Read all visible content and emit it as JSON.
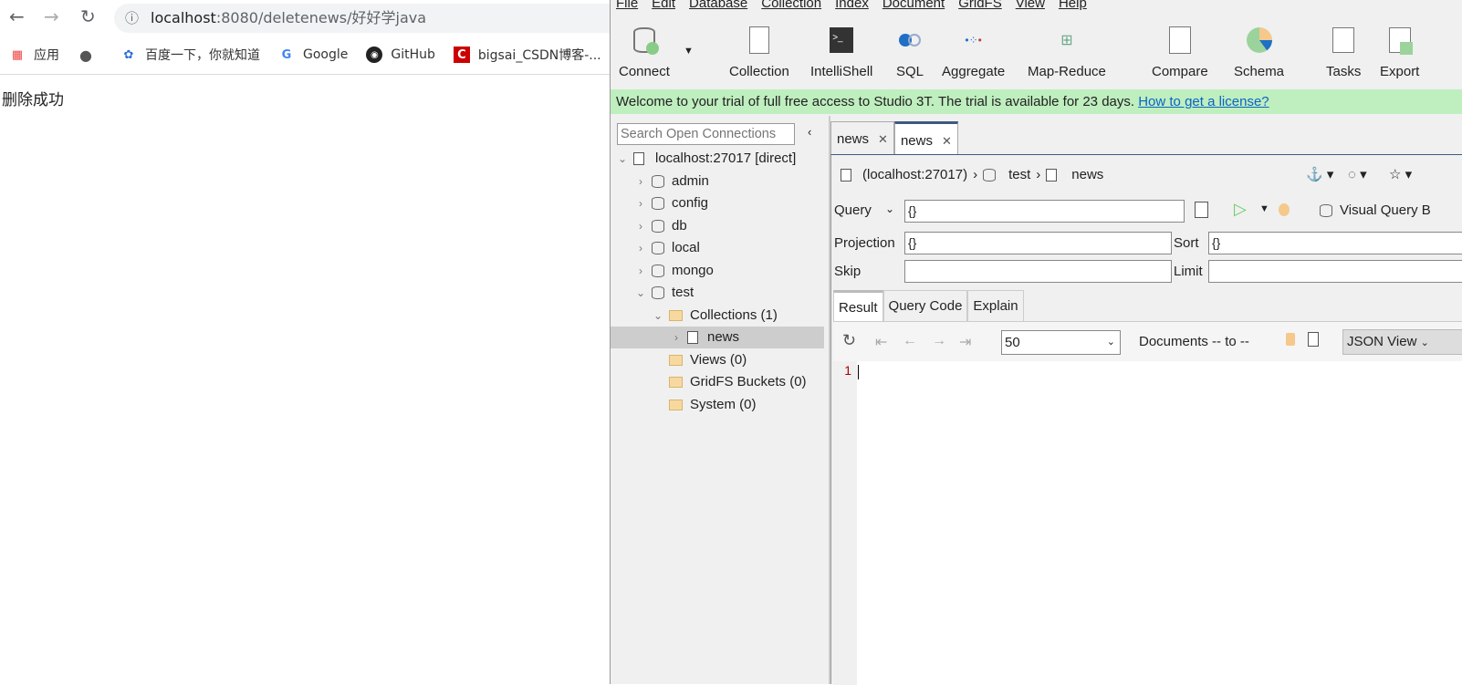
{
  "browser": {
    "url_host": "localhost",
    "url_path": ":8080/deletenews/好好学java",
    "bookmarks": [
      {
        "label": "应用",
        "icon": "apps-grid-icon"
      },
      {
        "label": "",
        "icon": "globe-icon"
      },
      {
        "label": "百度一下，你就知道",
        "icon": "baidu-paw-icon"
      },
      {
        "label": "Google",
        "icon": "google-icon"
      },
      {
        "label": "GitHub",
        "icon": "github-icon"
      },
      {
        "label": "bigsai_CSDN博客-...",
        "icon": "csdn-icon"
      }
    ],
    "message": "删除成功"
  },
  "app": {
    "menu": [
      "File",
      "Edit",
      "Database",
      "Collection",
      "Index",
      "Document",
      "GridFS",
      "View",
      "Help"
    ],
    "toolbar": [
      "Connect",
      "Collection",
      "IntelliShell",
      "SQL",
      "Aggregate",
      "Map-Reduce",
      "Compare",
      "Schema",
      "Tasks",
      "Export"
    ],
    "banner_text": "Welcome to your trial of full free access to Studio 3T. The trial is available for 23 days.",
    "banner_link": "How to get a license?",
    "search_placeholder": "Search Open Connections",
    "tree": {
      "connection": "localhost:27017 [direct]",
      "databases": [
        "admin",
        "config",
        "db",
        "local",
        "mongo",
        "test"
      ],
      "collections_folder": "Collections (1)",
      "collection": "news",
      "views": "Views (0)",
      "gridfs": "GridFS Buckets (0)",
      "system": "System (0)"
    },
    "tabs": [
      {
        "label": "news",
        "active": false
      },
      {
        "label": "news",
        "active": true
      }
    ],
    "breadcrumb": {
      "conn": "(localhost:27017)",
      "db": "test",
      "coll": "news"
    },
    "query": {
      "query_label": "Query",
      "query_value": "{}",
      "projection_label": "Projection",
      "projection_value": "{}",
      "sort_label": "Sort",
      "sort_value": "{}",
      "skip_label": "Skip",
      "skip_value": "",
      "limit_label": "Limit",
      "limit_value": "",
      "vqb_label": "Visual Query B"
    },
    "result_tabs": [
      "Result",
      "Query Code",
      "Explain"
    ],
    "result_bar": {
      "page_size": "50",
      "documents": "Documents -- to --",
      "view": "JSON View"
    },
    "editor": {
      "line": "1"
    },
    "colors": {
      "banner": "#bfeebf",
      "link": "#0b63c5",
      "tab_active_border": "#3d5a80"
    }
  }
}
